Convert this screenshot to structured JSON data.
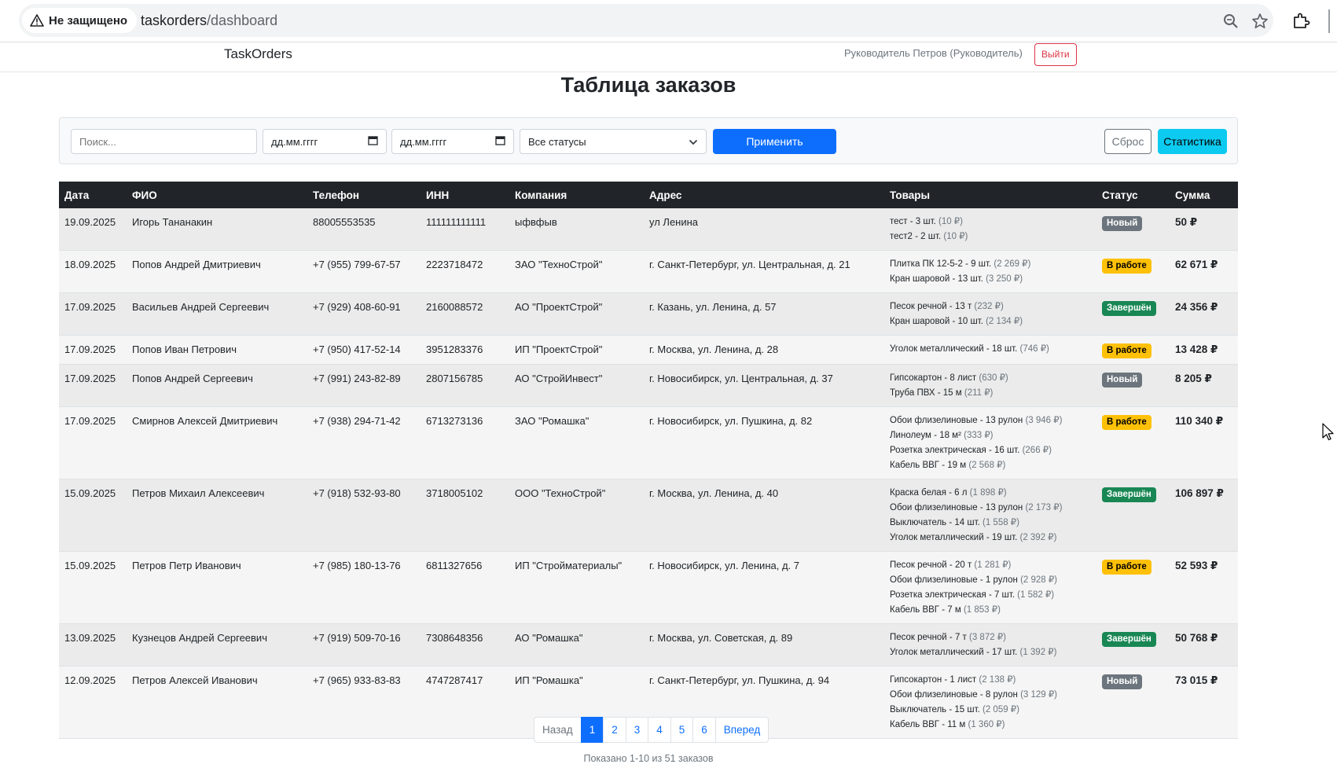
{
  "browser": {
    "security_label": "Не защищено",
    "url_host": "taskorders",
    "url_path": "/dashboard"
  },
  "navbar": {
    "brand": "TaskOrders",
    "user": "Руководитель Петров (Руководитель)",
    "logout_label": "Выйти"
  },
  "page_title": "Таблица заказов",
  "filters": {
    "search_placeholder": "Поиск...",
    "date_from_placeholder": "дд.мм.гггг",
    "date_to_placeholder": "дд.мм.гггг",
    "status_selected": "Все статусы",
    "apply_label": "Применить",
    "reset_label": "Сброс",
    "stats_label": "Статистика"
  },
  "table": {
    "columns": [
      "Дата",
      "ФИО",
      "Телефон",
      "ИНН",
      "Компания",
      "Адрес",
      "Товары",
      "Статус",
      "Сумма"
    ],
    "rows": [
      {
        "date": "19.09.2025",
        "name": "Игорь Тананакин",
        "phone": "88005553535",
        "inn": "111111111111",
        "company": "ыфвфыв",
        "address": "ул Ленина",
        "goods": [
          {
            "item": "тест - 3 шт.",
            "price": "(10 ₽)"
          },
          {
            "item": "тест2 - 2 шт.",
            "price": "(10 ₽)"
          }
        ],
        "status": "Новый",
        "status_kind": "new",
        "sum": "50 ₽"
      },
      {
        "date": "18.09.2025",
        "name": "Попов Андрей Дмитриевич",
        "phone": "+7 (955) 799-67-57",
        "inn": "2223718472",
        "company": "ЗАО \"ТехноСтрой\"",
        "address": "г. Санкт-Петербург, ул. Центральная, д. 21",
        "goods": [
          {
            "item": "Плитка ПК 12-5-2 - 9 шт.",
            "price": "(2 269 ₽)"
          },
          {
            "item": "Кран шаровой - 13 шт.",
            "price": "(3 250 ₽)"
          }
        ],
        "status": "В работе",
        "status_kind": "work",
        "sum": "62 671 ₽"
      },
      {
        "date": "17.09.2025",
        "name": "Васильев Андрей Сергеевич",
        "phone": "+7 (929) 408-60-91",
        "inn": "2160088572",
        "company": "АО \"ПроектСтрой\"",
        "address": "г. Казань, ул. Ленина, д. 57",
        "goods": [
          {
            "item": "Песок речной - 13 т",
            "price": "(232 ₽)"
          },
          {
            "item": "Кран шаровой - 10 шт.",
            "price": "(2 134 ₽)"
          }
        ],
        "status": "Завершён",
        "status_kind": "done",
        "sum": "24 356 ₽"
      },
      {
        "date": "17.09.2025",
        "name": "Попов Иван Петрович",
        "phone": "+7 (950) 417-52-14",
        "inn": "3951283376",
        "company": "ИП \"ПроектСтрой\"",
        "address": "г. Москва, ул. Ленина, д. 28",
        "goods": [
          {
            "item": "Уголок металлический - 18 шт.",
            "price": "(746 ₽)"
          }
        ],
        "status": "В работе",
        "status_kind": "work",
        "sum": "13 428 ₽"
      },
      {
        "date": "17.09.2025",
        "name": "Попов Андрей Сергеевич",
        "phone": "+7 (991) 243-82-89",
        "inn": "2807156785",
        "company": "АО \"СтройИнвест\"",
        "address": "г. Новосибирск, ул. Центральная, д. 37",
        "goods": [
          {
            "item": "Гипсокартон - 8 лист",
            "price": "(630 ₽)"
          },
          {
            "item": "Труба ПВХ - 15 м",
            "price": "(211 ₽)"
          }
        ],
        "status": "Новый",
        "status_kind": "new",
        "sum": "8 205 ₽"
      },
      {
        "date": "17.09.2025",
        "name": "Смирнов Алексей Дмитриевич",
        "phone": "+7 (938) 294-71-42",
        "inn": "6713273136",
        "company": "ЗАО \"Ромашка\"",
        "address": "г. Новосибирск, ул. Пушкина, д. 82",
        "goods": [
          {
            "item": "Обои флизелиновые - 13 рулон",
            "price": "(3 946 ₽)"
          },
          {
            "item": "Линолеум - 18 м²",
            "price": "(333 ₽)"
          },
          {
            "item": "Розетка электрическая - 16 шт.",
            "price": "(266 ₽)"
          },
          {
            "item": "Кабель ВВГ - 19 м",
            "price": "(2 568 ₽)"
          }
        ],
        "status": "В работе",
        "status_kind": "work",
        "sum": "110 340 ₽"
      },
      {
        "date": "15.09.2025",
        "name": "Петров Михаил Алексеевич",
        "phone": "+7 (918) 532-93-80",
        "inn": "3718005102",
        "company": "ООО \"ТехноСтрой\"",
        "address": "г. Москва, ул. Ленина, д. 40",
        "goods": [
          {
            "item": "Краска белая - 6 л",
            "price": "(1 898 ₽)"
          },
          {
            "item": "Обои флизелиновые - 13 рулон",
            "price": "(2 173 ₽)"
          },
          {
            "item": "Выключатель - 14 шт.",
            "price": "(1 558 ₽)"
          },
          {
            "item": "Уголок металлический - 19 шт.",
            "price": "(2 392 ₽)"
          }
        ],
        "status": "Завершён",
        "status_kind": "done",
        "sum": "106 897 ₽"
      },
      {
        "date": "15.09.2025",
        "name": "Петров Петр Иванович",
        "phone": "+7 (985) 180-13-76",
        "inn": "6811327656",
        "company": "ИП \"Стройматериалы\"",
        "address": "г. Новосибирск, ул. Ленина, д. 7",
        "goods": [
          {
            "item": "Песок речной - 20 т",
            "price": "(1 281 ₽)"
          },
          {
            "item": "Обои флизелиновые - 1 рулон",
            "price": "(2 928 ₽)"
          },
          {
            "item": "Розетка электрическая - 7 шт.",
            "price": "(1 582 ₽)"
          },
          {
            "item": "Кабель ВВГ - 7 м",
            "price": "(1 853 ₽)"
          }
        ],
        "status": "В работе",
        "status_kind": "work",
        "sum": "52 593 ₽"
      },
      {
        "date": "13.09.2025",
        "name": "Кузнецов Андрей Сергеевич",
        "phone": "+7 (919) 509-70-16",
        "inn": "7308648356",
        "company": "АО \"Ромашка\"",
        "address": "г. Москва, ул. Советская, д. 89",
        "goods": [
          {
            "item": "Песок речной - 7 т",
            "price": "(3 872 ₽)"
          },
          {
            "item": "Уголок металлический - 17 шт.",
            "price": "(1 392 ₽)"
          }
        ],
        "status": "Завершён",
        "status_kind": "done",
        "sum": "50 768 ₽"
      },
      {
        "date": "12.09.2025",
        "name": "Петров Алексей Иванович",
        "phone": "+7 (965) 933-83-83",
        "inn": "4747287417",
        "company": "ИП \"Ромашка\"",
        "address": "г. Санкт-Петербург, ул. Пушкина, д. 94",
        "goods": [
          {
            "item": "Гипсокартон - 1 лист",
            "price": "(2 138 ₽)"
          },
          {
            "item": "Обои флизелиновые - 8 рулон",
            "price": "(3 129 ₽)"
          },
          {
            "item": "Выключатель - 15 шт.",
            "price": "(2 059 ₽)"
          },
          {
            "item": "Кабель ВВГ - 11 м",
            "price": "(1 360 ₽)"
          }
        ],
        "status": "Новый",
        "status_kind": "new",
        "sum": "73 015 ₽"
      }
    ]
  },
  "pagination": {
    "prev_label": "Назад",
    "pages": [
      "1",
      "2",
      "3",
      "4",
      "5",
      "6"
    ],
    "active_page": "1",
    "next_label": "Вперед"
  },
  "summary": "Показано 1-10 из 51 заказов",
  "colors": {
    "primary": "#0d6efd",
    "info": "#0dcaf0",
    "warning": "#ffc107",
    "success": "#198754",
    "secondary": "#6c757d",
    "danger": "#dc3545",
    "dark": "#212529"
  }
}
